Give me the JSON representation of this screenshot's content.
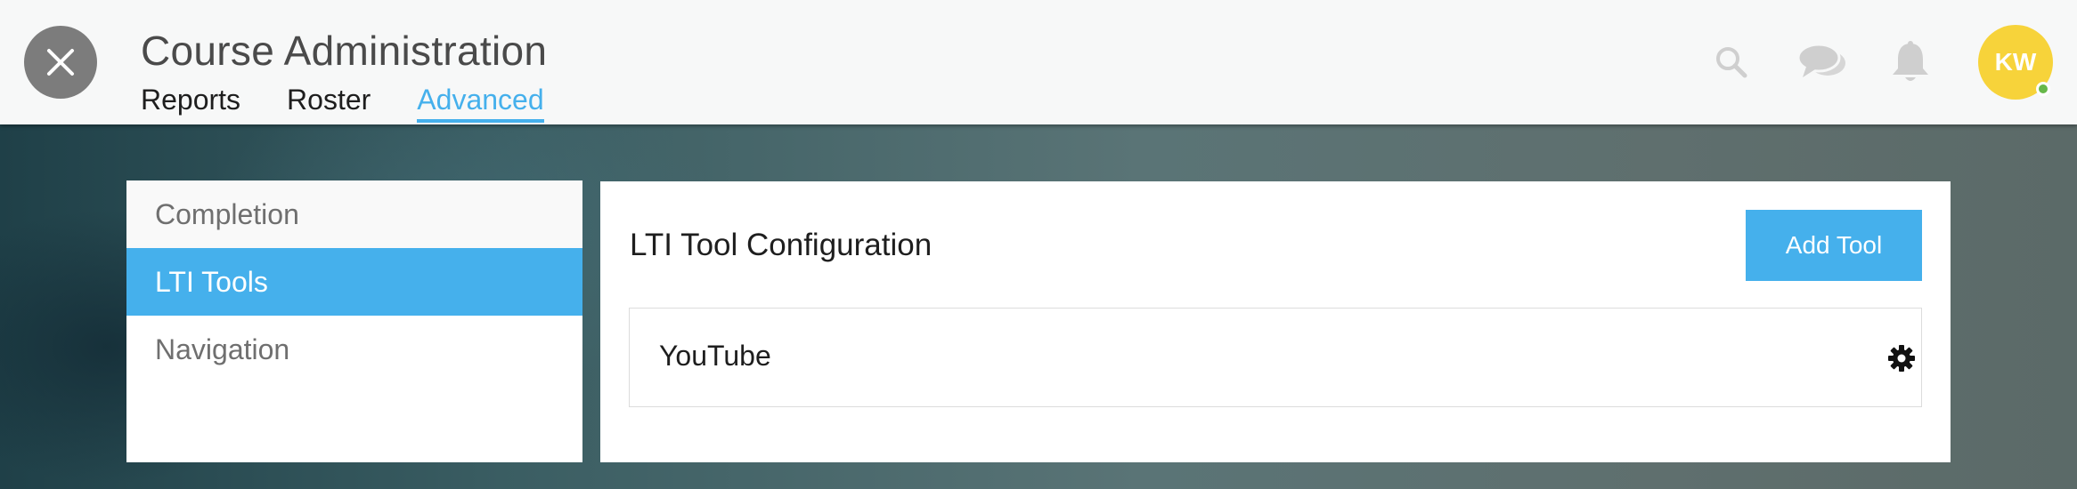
{
  "header": {
    "title": "Course Administration",
    "tabs": [
      {
        "label": "Reports",
        "active": false
      },
      {
        "label": "Roster",
        "active": false
      },
      {
        "label": "Advanced",
        "active": true
      }
    ],
    "icons": [
      "close-icon",
      "search-icon",
      "chat-icon",
      "bell-icon"
    ],
    "avatar_initials": "KW",
    "avatar_color": "#f7d33a",
    "presence_color": "#67b84a"
  },
  "sidebar": {
    "items": [
      {
        "label": "Completion",
        "active": false
      },
      {
        "label": "LTI Tools",
        "active": true
      },
      {
        "label": "Navigation",
        "active": false
      }
    ]
  },
  "main": {
    "section_title": "LTI Tool Configuration",
    "add_button_label": "Add Tool",
    "tools": [
      {
        "name": "YouTube",
        "icon": "gear-icon"
      }
    ]
  },
  "colors": {
    "accent": "#45b0ec",
    "header_bg": "#f7f8f8"
  }
}
